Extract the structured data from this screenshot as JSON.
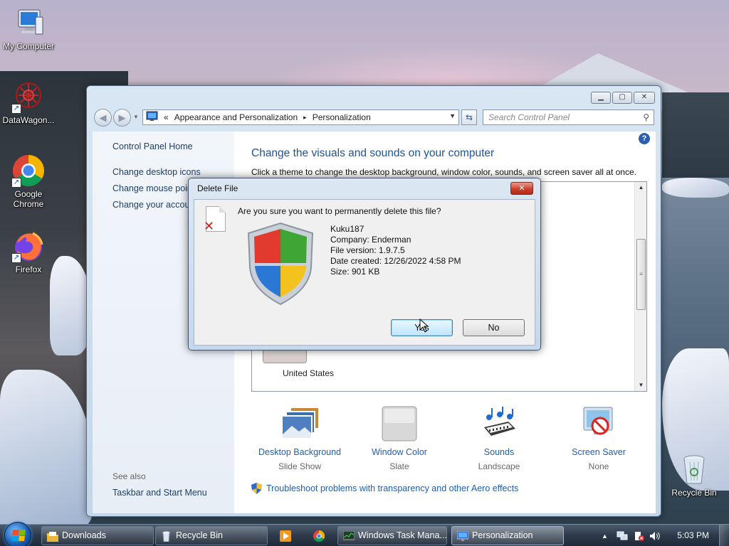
{
  "desktop": {
    "icons": [
      {
        "label": "My Computer",
        "icon": "computer-icon"
      },
      {
        "label": "DataWagon...",
        "icon": "datawagon-icon"
      },
      {
        "label": "Google Chrome",
        "icon": "chrome-icon"
      },
      {
        "label": "Firefox",
        "icon": "firefox-icon"
      },
      {
        "label": "Recycle Bin",
        "icon": "recycle-bin-icon"
      }
    ]
  },
  "window": {
    "address": {
      "prefix": "«",
      "segments": [
        "Appearance and Personalization",
        "Personalization"
      ],
      "separator": "▸"
    },
    "search_placeholder": "Search Control Panel",
    "sidebar": {
      "links": [
        "Control Panel Home",
        "Change desktop icons",
        "Change mouse pointers",
        "Change your account picture"
      ],
      "see_also": "See also",
      "see_also_links": [
        "Taskbar and Start Menu"
      ]
    },
    "content": {
      "title": "Change the visuals and sounds on your computer",
      "subtitle": "Click a theme to change the desktop background, window color, sounds, and screen saver all at once.",
      "theme_label": "United States",
      "options": [
        {
          "title": "Desktop Background",
          "value": "Slide Show",
          "icon": "desktop-background-icon"
        },
        {
          "title": "Window Color",
          "value": "Slate",
          "icon": "window-color-icon"
        },
        {
          "title": "Sounds",
          "value": "Landscape",
          "icon": "sounds-icon"
        },
        {
          "title": "Screen Saver",
          "value": "None",
          "icon": "screen-saver-icon"
        }
      ],
      "troubleshoot_link": "Troubleshoot problems with transparency and other Aero effects"
    }
  },
  "dialog": {
    "title": "Delete File",
    "question": "Are you sure you want to permanently delete this file?",
    "file_info": [
      "Kuku187",
      "Company: Enderman",
      "File version: 1.9.7.5",
      "Date created: 12/26/2022 4:58 PM",
      "Size: 901 KB"
    ],
    "yes_label": "Yes",
    "no_label": "No"
  },
  "taskbar": {
    "buttons": [
      {
        "label": "Downloads",
        "icon": "folder-icon"
      },
      {
        "label": "Recycle Bin",
        "icon": "recycle-bin-icon"
      },
      {
        "label": "Windows Task Mana...",
        "icon": "task-manager-icon"
      },
      {
        "label": "Personalization",
        "icon": "personalization-icon"
      }
    ],
    "pinned": [
      "media-player-icon",
      "chrome-icon"
    ],
    "clock": "5:03 PM"
  },
  "colors": {
    "link": "#1e5fb3",
    "title_blue": "#1e5495",
    "close_red": "#c8412c",
    "default_button": "#bee6fd"
  }
}
